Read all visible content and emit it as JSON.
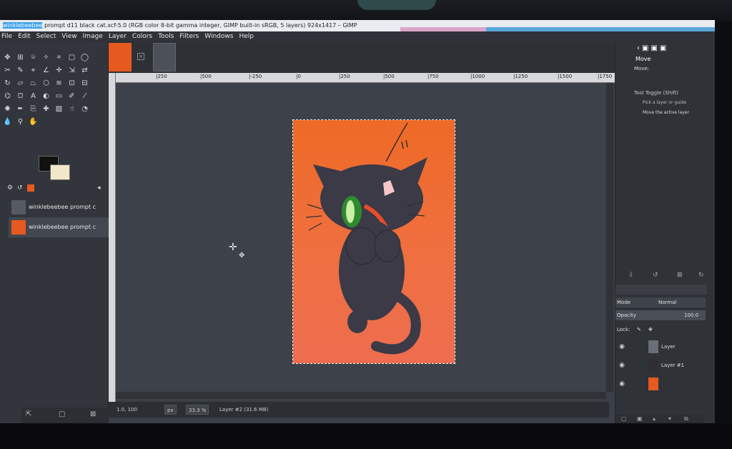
{
  "window": {
    "title_highlight": "winklebeebee",
    "title_rest": " prompt d11 black cat.xcf-5.0 (RGB color 8-bit gamma integer, GIMP built-in sRGB, 5 layers) 924x1417 – GIMP"
  },
  "menu": [
    "File",
    "Edit",
    "Select",
    "View",
    "Image",
    "Layer",
    "Colors",
    "Tools",
    "Filters",
    "Windows",
    "Help"
  ],
  "images_list": [
    {
      "label": "winklebeebee prompt c"
    },
    {
      "label": "winklebeebee prompt c"
    }
  ],
  "ruler": {
    "ticks": [
      "|250",
      "|500",
      "|-250",
      "|0",
      "|250",
      "|500",
      "|750",
      "|1000",
      "|1250",
      "|1500",
      "|1750"
    ]
  },
  "status": {
    "coords": "1.0, 100",
    "unit": "px",
    "zoom": "33.3 %",
    "layer_info": "Layer #2 (31.6 MB)"
  },
  "tool_options": {
    "title": "Move",
    "move_label": "Move:",
    "toggle_label": "Tool Toggle  (Shift)",
    "option1": "Pick a layer or guide",
    "option2": "Move the active layer"
  },
  "layers": {
    "mode_label": "Mode",
    "mode_value": "Normal",
    "opacity_label": "Opacity",
    "opacity_value": "100.0",
    "lock_label": "Lock:",
    "items": [
      {
        "name": "Layer",
        "color": "#6a6e76"
      },
      {
        "name": "Layer #1",
        "color": "#2e2e34"
      },
      {
        "name": "",
        "color": "#e65a1f"
      }
    ]
  },
  "colors": {
    "accent_orange": "#ee6a26",
    "fg": "#111111",
    "bg": "#f0e8c8"
  }
}
